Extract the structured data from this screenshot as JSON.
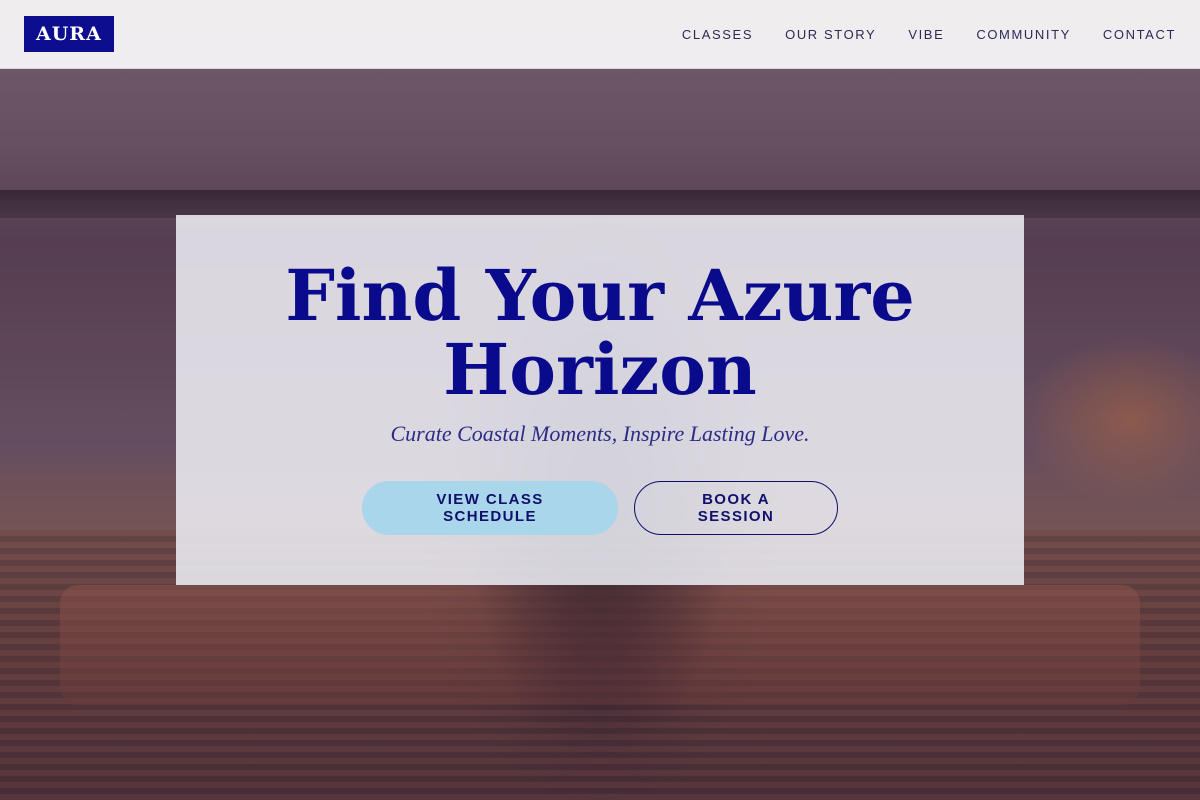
{
  "brand": {
    "logo_text": "AURA"
  },
  "nav": {
    "links": [
      "CLASSES",
      "OUR STORY",
      "VIBE",
      "COMMUNITY",
      "CONTACT"
    ]
  },
  "hero": {
    "title": "Find Your Azure Horizon",
    "subtitle": "Curate Coastal Moments, Inspire Lasting Love.",
    "primary_cta": "VIEW CLASS SCHEDULE",
    "secondary_cta": "BOOK A SESSION",
    "background_image": "person-meditating-silhouette"
  },
  "colors": {
    "brand_navy": "#0d0d8f",
    "primary_button_bg": "#a9d6ea",
    "text_navy": "#10106a"
  }
}
